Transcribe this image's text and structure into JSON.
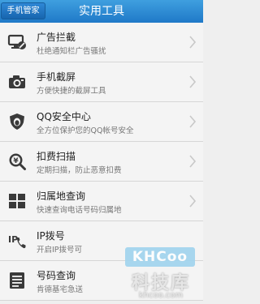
{
  "header": {
    "back_label": "手机管家",
    "title": "实用工具"
  },
  "items": [
    {
      "title": "广告拦截",
      "desc": "杜绝通知栏广告骚扰",
      "icon": "ad-block-icon"
    },
    {
      "title": "手机截屏",
      "desc": "方便快捷的截屏工具",
      "icon": "camera-icon"
    },
    {
      "title": "QQ安全中心",
      "desc": "全方位保护您的QQ帐号安全",
      "icon": "qq-shield-icon"
    },
    {
      "title": "扣费扫描",
      "desc": "定期扫描，防止恶意扣费",
      "icon": "money-scan-icon"
    },
    {
      "title": "归属地查询",
      "desc": "快速查询电话号码归属地",
      "icon": "grid-icon"
    },
    {
      "title": "IP拨号",
      "desc": "开启IP拨号可",
      "icon": "ip-dial-icon"
    },
    {
      "title": "号码查询",
      "desc": "肯德基宅急送",
      "icon": "number-list-icon"
    }
  ],
  "watermark": {
    "logo": "KHCoo",
    "name": "科技库",
    "url": "khcoo.com"
  }
}
